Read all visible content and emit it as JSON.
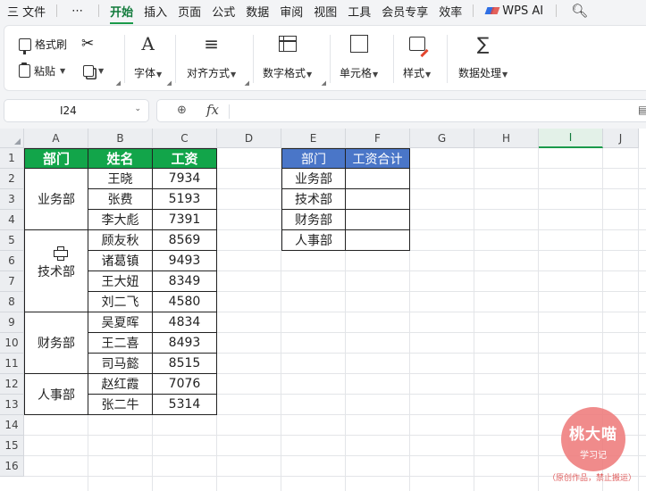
{
  "menu": {
    "items": [
      "三 文件",
      "⋯",
      "开始",
      "插入",
      "页面",
      "公式",
      "数据",
      "审阅",
      "视图",
      "工具",
      "会员专享",
      "效率"
    ],
    "active": "开始",
    "wps_ai": "WPS AI"
  },
  "ribbon": {
    "format_painter": "格式刷",
    "paste": "粘贴",
    "font": "字体",
    "align": "对齐方式",
    "number_format": "数字格式",
    "cell": "单元格",
    "style": "样式",
    "data_process": "数据处理"
  },
  "formula_bar": {
    "name_box": "I24",
    "fx": "fx",
    "formula": ""
  },
  "sheet": {
    "columns": [
      "A",
      "B",
      "C",
      "D",
      "E",
      "F",
      "G",
      "H",
      "I",
      "J"
    ],
    "selected_column": "I",
    "rows": [
      "1",
      "2",
      "3",
      "4",
      "5",
      "6",
      "7",
      "8",
      "9",
      "10",
      "11",
      "12",
      "13",
      "14",
      "15",
      "16"
    ]
  },
  "left_table": {
    "headers": [
      "部门",
      "姓名",
      "工资"
    ],
    "groups": [
      {
        "dept": "业务部",
        "rows": [
          {
            "name": "王晓",
            "salary": "7934"
          },
          {
            "name": "张费",
            "salary": "5193"
          },
          {
            "name": "李大彪",
            "salary": "7391"
          }
        ]
      },
      {
        "dept": "技术部",
        "rows": [
          {
            "name": "顾友秋",
            "salary": "8569"
          },
          {
            "name": "诸葛镇",
            "salary": "9493"
          },
          {
            "name": "王大妞",
            "salary": "8349"
          },
          {
            "name": "刘二飞",
            "salary": "4580"
          }
        ]
      },
      {
        "dept": "财务部",
        "rows": [
          {
            "name": "吴夏晖",
            "salary": "4834"
          },
          {
            "name": "王二喜",
            "salary": "8493"
          },
          {
            "name": "司马懿",
            "salary": "8515"
          }
        ]
      },
      {
        "dept": "人事部",
        "rows": [
          {
            "name": "赵红霞",
            "salary": "7076"
          },
          {
            "name": "张二牛",
            "salary": "5314"
          }
        ]
      }
    ]
  },
  "right_table": {
    "headers": [
      "部门",
      "工资合计"
    ],
    "rows": [
      {
        "dept": "业务部",
        "total": ""
      },
      {
        "dept": "技术部",
        "total": ""
      },
      {
        "dept": "财务部",
        "total": ""
      },
      {
        "dept": "人事部",
        "total": ""
      }
    ]
  },
  "watermark": {
    "title": "桃大喵",
    "subtitle": "学习记",
    "note": "（原创作品，禁止搬运）"
  },
  "colors": {
    "accent_green": "#12a54a",
    "header_blue": "#4a76c8"
  }
}
